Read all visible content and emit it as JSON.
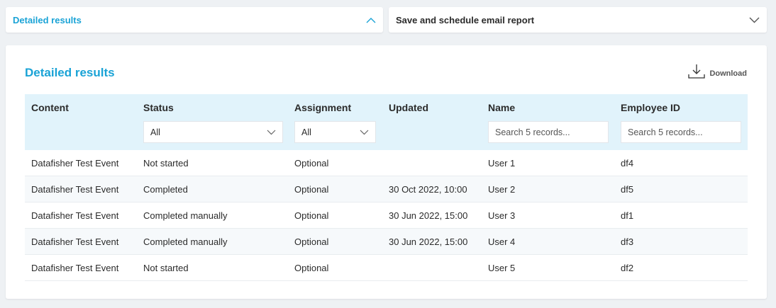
{
  "accordion": {
    "detailed_label": "Detailed results",
    "schedule_label": "Save and schedule email report"
  },
  "panel": {
    "title": "Detailed results",
    "download_label": "Download"
  },
  "table": {
    "headers": {
      "content": "Content",
      "status": "Status",
      "assignment": "Assignment",
      "updated": "Updated",
      "name": "Name",
      "employee_id": "Employee ID"
    },
    "filters": {
      "status_value": "All",
      "assignment_value": "All",
      "name_placeholder": "Search 5 records...",
      "employee_placeholder": "Search 5 records..."
    },
    "rows": [
      {
        "content": "Datafisher Test Event",
        "status": "Not started",
        "assignment": "Optional",
        "updated": "",
        "name": "User 1",
        "employee_id": "df4"
      },
      {
        "content": "Datafisher Test Event",
        "status": "Completed",
        "assignment": "Optional",
        "updated": "30 Oct 2022, 10:00",
        "name": "User 2",
        "employee_id": "df5"
      },
      {
        "content": "Datafisher Test Event",
        "status": "Completed manually",
        "assignment": "Optional",
        "updated": "30 Jun 2022, 15:00",
        "name": "User 3",
        "employee_id": "df1"
      },
      {
        "content": "Datafisher Test Event",
        "status": "Completed manually",
        "assignment": "Optional",
        "updated": "30 Jun 2022, 15:00",
        "name": "User 4",
        "employee_id": "df3"
      },
      {
        "content": "Datafisher Test Event",
        "status": "Not started",
        "assignment": "Optional",
        "updated": "",
        "name": "User 5",
        "employee_id": "df2"
      }
    ]
  },
  "colors": {
    "accent": "#1aa3d6",
    "header_bg": "#e1f3fb",
    "page_bg": "#eef1f4"
  },
  "icons": {
    "accordion_open": "chevron-up-icon",
    "accordion_closed": "chevron-down-icon",
    "download": "download-icon",
    "select": "chevron-down-icon"
  }
}
